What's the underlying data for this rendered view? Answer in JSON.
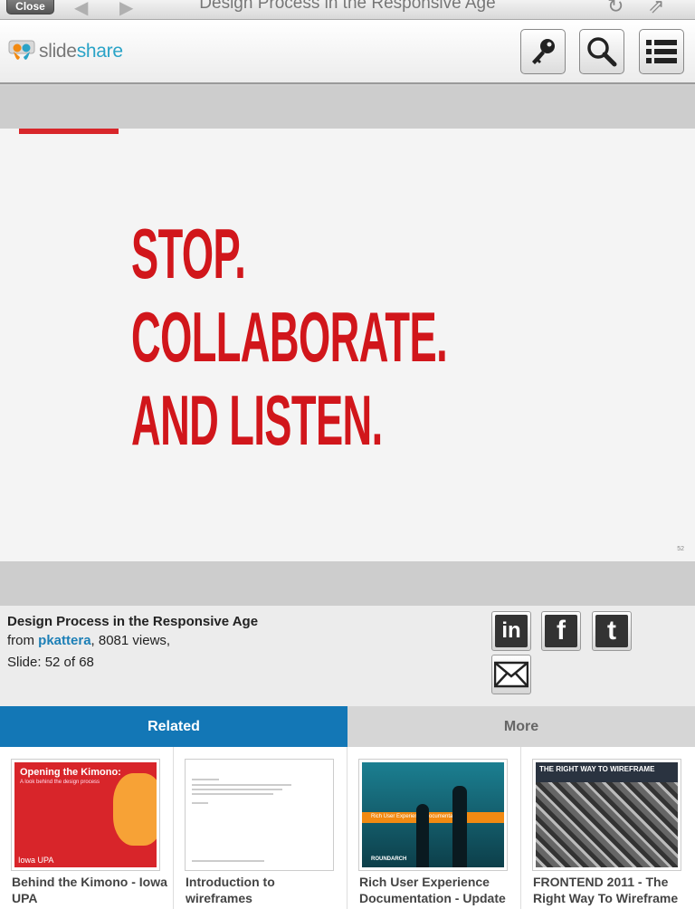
{
  "browser": {
    "close_label": "Close",
    "title": "Design Process in the Responsive Age"
  },
  "header": {
    "logo_part1": "slide",
    "logo_part2": "share"
  },
  "slide": {
    "lines": [
      "STOP.",
      "COLLABORATE.",
      "AND LISTEN."
    ],
    "number": "52"
  },
  "info": {
    "title": "Design Process in the Responsive Age",
    "from_label": "from",
    "author": "pkattera",
    "views": ", 8081 views,",
    "slide_label": "Slide: 52 of 68"
  },
  "share": {
    "linkedin": "in",
    "facebook": "f",
    "twitter": "t"
  },
  "tabs": {
    "related": "Related",
    "more": "More"
  },
  "related": [
    {
      "title": "Behind the Kimono - Iowa UPA",
      "thumb_title": "Opening the Kimono:",
      "thumb_sub": "A look behind the design process",
      "thumb_foot": "Iowa UPA"
    },
    {
      "title": "Introduction to wireframes"
    },
    {
      "title": "Rich User Experience Documentation - Update",
      "thumb_band": "Rich User Experience Documentation",
      "thumb_brand": "ROUNDARCH"
    },
    {
      "title": "FRONTEND 2011 - The Right Way To Wireframe",
      "thumb_title": "THE RIGHT WAY TO WIREFRAME"
    }
  ],
  "colors": {
    "accent": "#1377b6",
    "slide_red": "#d1161b",
    "author_link": "#1c7fb6"
  }
}
